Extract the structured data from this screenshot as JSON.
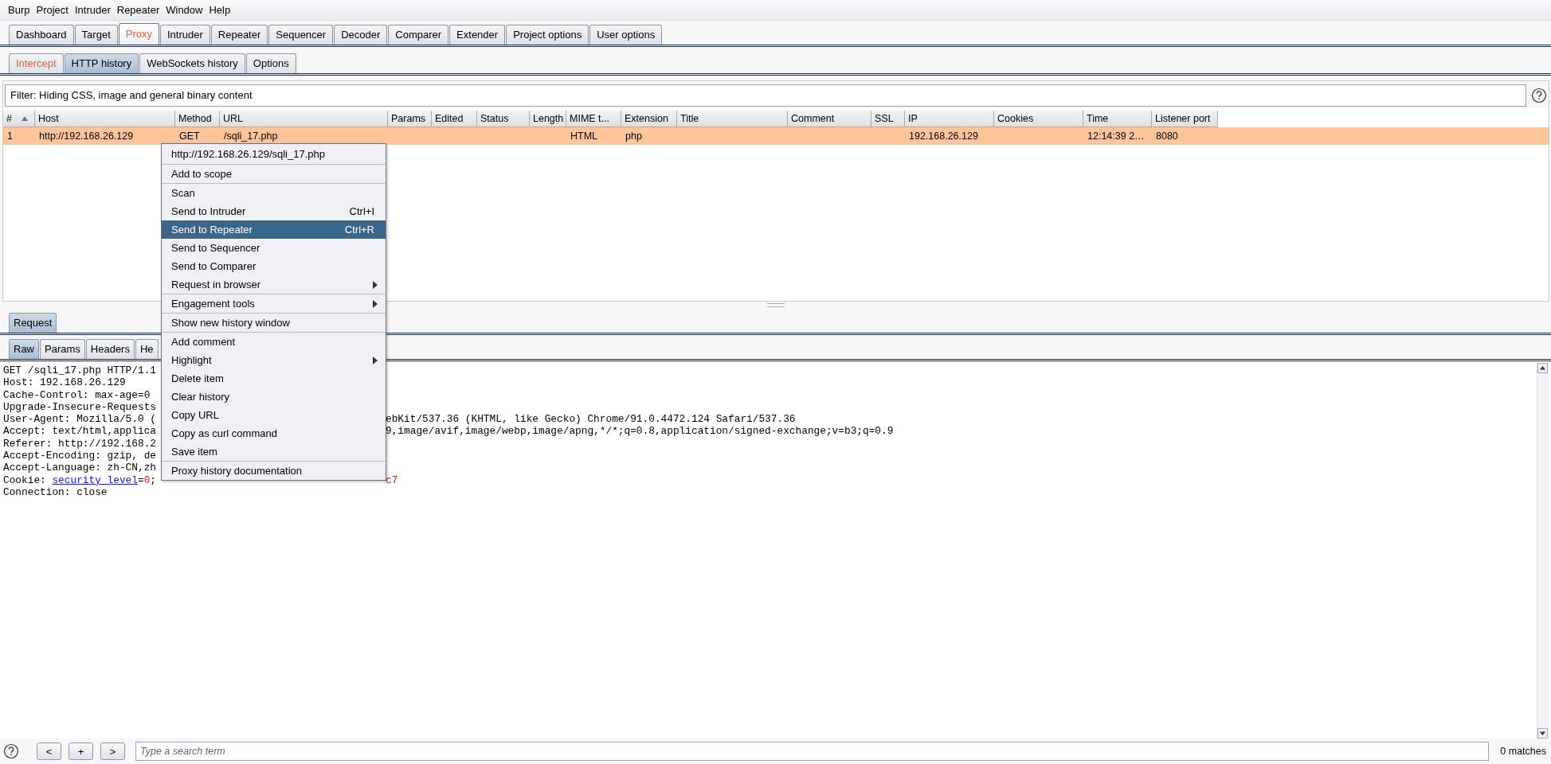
{
  "menu_bar": [
    "Burp",
    "Project",
    "Intruder",
    "Repeater",
    "Window",
    "Help"
  ],
  "main_tabs": [
    {
      "label": "Dashboard",
      "selected": false,
      "highlighted": false
    },
    {
      "label": "Target",
      "selected": false,
      "highlighted": false
    },
    {
      "label": "Proxy",
      "selected": true,
      "highlighted": true
    },
    {
      "label": "Intruder",
      "selected": false,
      "highlighted": false
    },
    {
      "label": "Repeater",
      "selected": false,
      "highlighted": false
    },
    {
      "label": "Sequencer",
      "selected": false,
      "highlighted": false
    },
    {
      "label": "Decoder",
      "selected": false,
      "highlighted": false
    },
    {
      "label": "Comparer",
      "selected": false,
      "highlighted": false
    },
    {
      "label": "Extender",
      "selected": false,
      "highlighted": false
    },
    {
      "label": "Project options",
      "selected": false,
      "highlighted": false
    },
    {
      "label": "User options",
      "selected": false,
      "highlighted": false
    }
  ],
  "proxy_tabs": [
    {
      "label": "Intercept",
      "selected": false,
      "highlighted": true
    },
    {
      "label": "HTTP history",
      "selected": true,
      "highlighted": false
    },
    {
      "label": "WebSockets history",
      "selected": false,
      "highlighted": false
    },
    {
      "label": "Options",
      "selected": false,
      "highlighted": false
    }
  ],
  "filter": {
    "text": "Filter: Hiding CSS, image and general binary content"
  },
  "history_table": {
    "columns": [
      {
        "label": "#",
        "sorted": true
      },
      {
        "label": "Host",
        "sorted": false
      },
      {
        "label": "Method",
        "sorted": false
      },
      {
        "label": "URL",
        "sorted": false
      },
      {
        "label": "Params",
        "sorted": false
      },
      {
        "label": "Edited",
        "sorted": false
      },
      {
        "label": "Status",
        "sorted": false
      },
      {
        "label": "Length",
        "sorted": false
      },
      {
        "label": "MIME t...",
        "sorted": false
      },
      {
        "label": "Extension",
        "sorted": false
      },
      {
        "label": "Title",
        "sorted": false
      },
      {
        "label": "Comment",
        "sorted": false
      },
      {
        "label": "SSL",
        "sorted": false
      },
      {
        "label": "IP",
        "sorted": false
      },
      {
        "label": "Cookies",
        "sorted": false
      },
      {
        "label": "Time",
        "sorted": false
      },
      {
        "label": "Listener port",
        "sorted": false
      }
    ],
    "rows": [
      {
        "color": "#ffc599",
        "number": "1",
        "host": "http://192.168.26.129",
        "method": "GET",
        "url": "/sqli_17.php",
        "mime_type": "HTML",
        "extension": "php",
        "ip": "192.168.26.129",
        "time": "12:14:39 2…",
        "listener_port": "8080"
      }
    ]
  },
  "message_tabs": [
    {
      "label": "Request",
      "selected": true
    }
  ],
  "editor_tabs": [
    {
      "label": "Raw",
      "selected": true
    },
    {
      "label": "Params",
      "selected": false
    },
    {
      "label": "Headers",
      "selected": false
    },
    {
      "label": "He",
      "selected": false
    }
  ],
  "request_lines": [
    {
      "left": [
        {
          "kind": "plain",
          "text": "GET /sqli_17.php HTTP/1.1"
        }
      ]
    },
    {
      "left": [
        {
          "kind": "plain",
          "text": "Host: 192.168.26.129"
        }
      ]
    },
    {
      "left": [
        {
          "kind": "plain",
          "text": "Cache-Control: max-age=0"
        }
      ]
    },
    {
      "left": [
        {
          "kind": "plain",
          "text": "Upgrade-Insecure-Requests"
        }
      ]
    },
    {
      "left": [
        {
          "kind": "plain",
          "text": "User-Agent: Mozilla/5.0 ("
        }
      ],
      "right": [
        {
          "kind": "plain",
          "text": "ebKit/537.36 (KHTML, like Gecko) Chrome/91.0.4472.124 Safari/537.36"
        }
      ]
    },
    {
      "left": [
        {
          "kind": "plain",
          "text": "Accept: text/html,applica"
        }
      ],
      "right": [
        {
          "kind": "plain",
          "text": "9,image/avif,image/webp,image/apng,*/*;q=0.8,application/signed-exchange;v=b3;q=0.9"
        }
      ]
    },
    {
      "left": [
        {
          "kind": "plain",
          "text": "Referer: http://192.168.2"
        }
      ]
    },
    {
      "left": [
        {
          "kind": "plain",
          "text": "Accept-Encoding: gzip, de"
        }
      ]
    },
    {
      "left": [
        {
          "kind": "plain",
          "text": "Accept-Language: zh-CN,zh"
        }
      ]
    },
    {
      "left": [
        {
          "kind": "plain",
          "text": "Cookie: "
        },
        {
          "kind": "param_name",
          "text": "security_level"
        },
        {
          "kind": "plain",
          "text": "="
        },
        {
          "kind": "param_value",
          "text": "0"
        },
        {
          "kind": "plain",
          "text": ";"
        }
      ],
      "right": [
        {
          "kind": "param_value",
          "text": "c7"
        }
      ]
    },
    {
      "left": [
        {
          "kind": "plain",
          "text": "Connection: close"
        }
      ]
    }
  ],
  "context_menu": [
    {
      "kind": "title",
      "items": [
        {
          "label": "http://192.168.26.129/sqli_17.php",
          "selected": false,
          "submenu": false
        }
      ]
    },
    {
      "kind": "items",
      "items": [
        {
          "label": "Add to scope",
          "selected": false,
          "submenu": false
        }
      ]
    },
    {
      "kind": "items",
      "items": [
        {
          "label": "Scan",
          "selected": false,
          "submenu": false
        },
        {
          "label": "Send to Intruder",
          "shortcut": "Ctrl+I",
          "selected": false,
          "submenu": false
        },
        {
          "label": "Send to Repeater",
          "shortcut": "Ctrl+R",
          "selected": true,
          "submenu": false
        },
        {
          "label": "Send to Sequencer",
          "selected": false,
          "submenu": false
        },
        {
          "label": "Send to Comparer",
          "selected": false,
          "submenu": false
        },
        {
          "label": "Request in browser",
          "selected": false,
          "submenu": true
        }
      ]
    },
    {
      "kind": "items",
      "items": [
        {
          "label": "Engagement tools",
          "selected": false,
          "submenu": true
        }
      ]
    },
    {
      "kind": "items",
      "items": [
        {
          "label": "Show new history window",
          "selected": false,
          "submenu": false
        }
      ]
    },
    {
      "kind": "items",
      "items": [
        {
          "label": "Add comment",
          "selected": false,
          "submenu": false
        },
        {
          "label": "Highlight",
          "selected": false,
          "submenu": true
        },
        {
          "label": "Delete item",
          "selected": false,
          "submenu": false
        },
        {
          "label": "Clear history",
          "selected": false,
          "submenu": false
        },
        {
          "label": "Copy URL",
          "selected": false,
          "submenu": false
        },
        {
          "label": "Copy as curl command",
          "selected": false,
          "submenu": false
        },
        {
          "label": "Save item",
          "selected": false,
          "submenu": false
        }
      ]
    },
    {
      "kind": "items",
      "items": [
        {
          "label": "Proxy history documentation",
          "selected": false,
          "submenu": false
        }
      ]
    }
  ],
  "search_bar": {
    "buttons": [
      "<",
      "+",
      ">"
    ],
    "placeholder": "Type a search term",
    "matches": "0 matches"
  }
}
